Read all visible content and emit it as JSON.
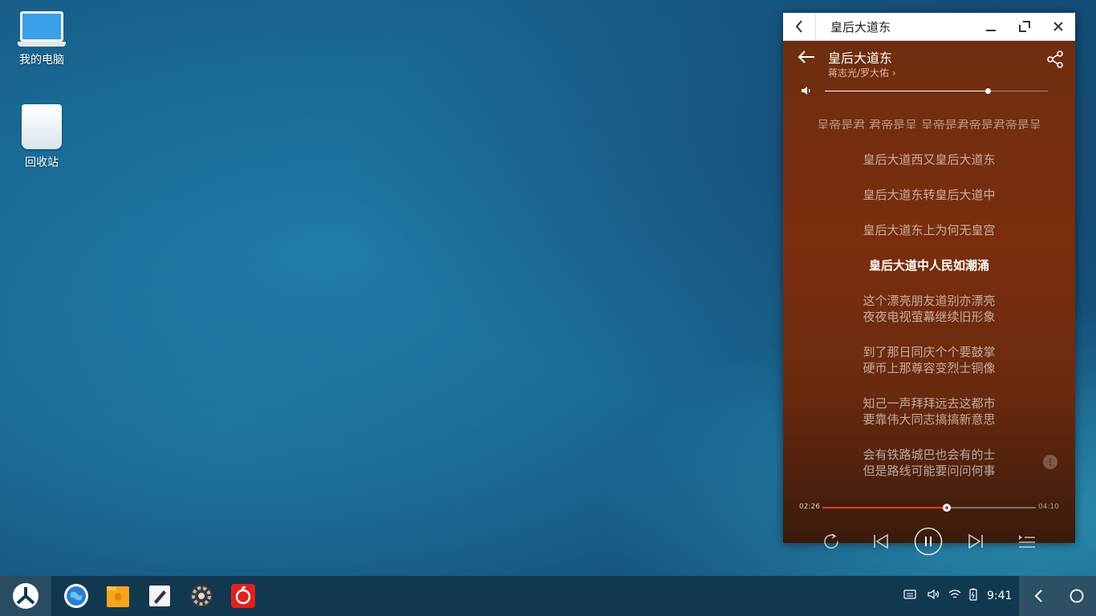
{
  "desktop": {
    "icons": [
      {
        "label": "我的电脑"
      },
      {
        "label": "回收站"
      }
    ]
  },
  "window": {
    "title": "皇后大道东"
  },
  "player": {
    "song_title": "皇后大道东",
    "artist": "蒋志光/罗大佑 ›",
    "volume_level": 0.73,
    "lyrics_partial": "呈帝是君 君帝是呈 呈帝是君帝是君帝是呈",
    "lyrics": [
      {
        "lines": [
          "皇后大道西又皇后大道东"
        ],
        "current": false
      },
      {
        "lines": [
          "皇后大道东转皇后大道中"
        ],
        "current": false
      },
      {
        "lines": [
          "皇后大道东上为何无皇宫"
        ],
        "current": false
      },
      {
        "lines": [
          "皇后大道中人民如潮涌"
        ],
        "current": true
      },
      {
        "lines": [
          "这个漂亮朋友道别亦漂亮",
          "夜夜电视萤幕继续旧形象"
        ],
        "current": false
      },
      {
        "lines": [
          "到了那日同庆个个要鼓掌",
          "硬币上那尊容变烈士铜像"
        ],
        "current": false
      },
      {
        "lines": [
          "知己一声拜拜远去这都市",
          "要靠伟大同志搞搞新意思"
        ],
        "current": false
      },
      {
        "lines": [
          "会有铁路城巴也会有的士",
          "但是路线可能要问问何事"
        ],
        "current": false
      }
    ],
    "time_current": "02:26",
    "time_total": "04:10",
    "progress": 0.583
  },
  "taskbar": {
    "apps": [
      "browser-icon",
      "files-icon",
      "editor-icon",
      "settings-icon",
      "netease-music-icon"
    ],
    "clock": "9:41"
  },
  "colors": {
    "player_bg": "#7a2e0e",
    "progress_accent": "#e03a2a",
    "taskbar_bg": "#12384f"
  }
}
